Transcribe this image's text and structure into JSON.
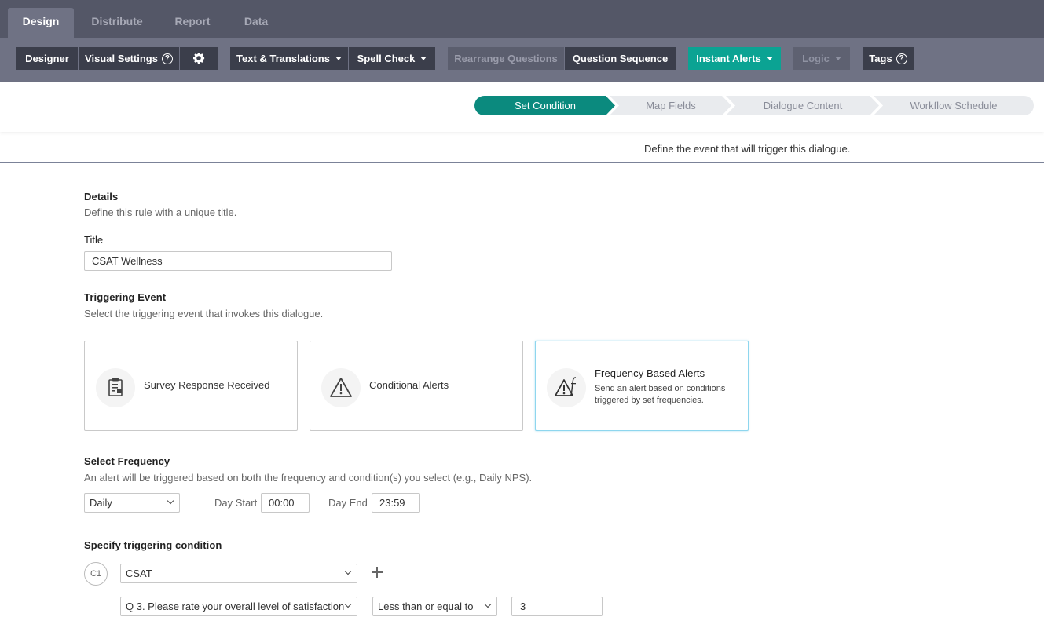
{
  "top_tabs": [
    {
      "label": "Design",
      "active": true
    },
    {
      "label": "Distribute",
      "active": false
    },
    {
      "label": "Report",
      "active": false
    },
    {
      "label": "Data",
      "active": false
    }
  ],
  "toolbar": {
    "designer": "Designer",
    "visual_settings": "Visual Settings",
    "help_glyph": "?",
    "settings_icon": "gear-icon",
    "text_translations": "Text & Translations",
    "spell_check": "Spell Check",
    "rearrange_questions": "Rearrange Questions",
    "question_sequence": "Question Sequence",
    "instant_alerts": "Instant Alerts",
    "logic": "Logic",
    "tags": "Tags"
  },
  "stepper": {
    "steps": [
      {
        "label": "Set Condition",
        "active": true
      },
      {
        "label": "Map Fields",
        "active": false
      },
      {
        "label": "Dialogue Content",
        "active": false
      },
      {
        "label": "Workflow Schedule",
        "active": false
      }
    ],
    "subtitle": "Define the event that will trigger this dialogue."
  },
  "details": {
    "heading": "Details",
    "description": "Define this rule with a unique title.",
    "title_label": "Title",
    "title_value": "CSAT Wellness"
  },
  "triggering_event": {
    "heading": "Triggering Event",
    "description": "Select the triggering event that invokes this dialogue.",
    "cards": [
      {
        "title": "Survey Response Received",
        "desc": "",
        "icon": "clipboard-icon",
        "selected": false
      },
      {
        "title": "Conditional Alerts",
        "desc": "",
        "icon": "warning-icon",
        "selected": false
      },
      {
        "title": "Frequency Based Alerts",
        "desc": "Send an alert based on conditions triggered by set frequencies.",
        "icon": "frequency-alert-icon",
        "selected": true
      }
    ]
  },
  "frequency": {
    "heading": "Select Frequency",
    "description": "An alert will be triggered based on both the frequency and condition(s) you select (e.g., Daily NPS).",
    "selected": "Daily",
    "day_start_label": "Day Start",
    "day_start_value": "00:00",
    "day_end_label": "Day End",
    "day_end_value": "23:59"
  },
  "condition": {
    "heading": "Specify triggering condition",
    "badge": "C1",
    "metric": "CSAT",
    "question": "Q 3. Please rate your overall level of satisfaction",
    "operator": "Less than or equal to",
    "value": "3"
  },
  "colors": {
    "accent_teal": "#0ba393",
    "step_active": "#0b8a7e",
    "topbar": "#545767",
    "toolbar": "#6f7284"
  }
}
